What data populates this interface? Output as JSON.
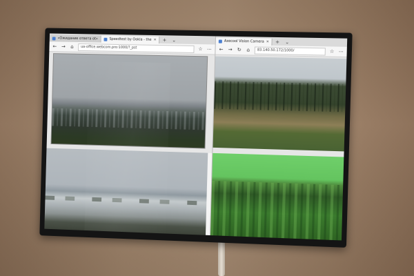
{
  "scene": {
    "wall_color": "#a3876d",
    "tv_bezel_color": "#141414"
  },
  "browser_left": {
    "tabs": [
      {
        "label": "«Ожидание ответа ot»",
        "icon": "loading-icon",
        "active": false
      },
      {
        "label": "Speedtest by Ookla - the",
        "icon": "speedtest-icon",
        "active": true
      }
    ],
    "new_tab": "+",
    "menu": "⌄",
    "address": "ua-office.webcom.pro:1000/?_pst",
    "nav": {
      "back": "←",
      "forward": "→",
      "refresh": "↻",
      "home": "⌂",
      "star": "☆",
      "more": "⋯"
    }
  },
  "browser_right": {
    "tabs": [
      {
        "label": "Axecool Vision Camera",
        "icon": "camera-icon",
        "active": true
      }
    ],
    "new_tab": "+",
    "menu": "⌄",
    "address": "83.140.50.172/1000/",
    "nav": {
      "back": "←",
      "forward": "→",
      "refresh": "↻",
      "home": "⌂",
      "star": "☆",
      "more": "⋯"
    }
  },
  "cameras": {
    "top_left": "village-landscape",
    "bottom_left": "river-floodplain",
    "top_right": "pine-forest-clearing",
    "bottom_right": "green-distorted-feed"
  },
  "colors": {
    "feed_green": "#6fcf6a",
    "forest": "#34432c"
  }
}
